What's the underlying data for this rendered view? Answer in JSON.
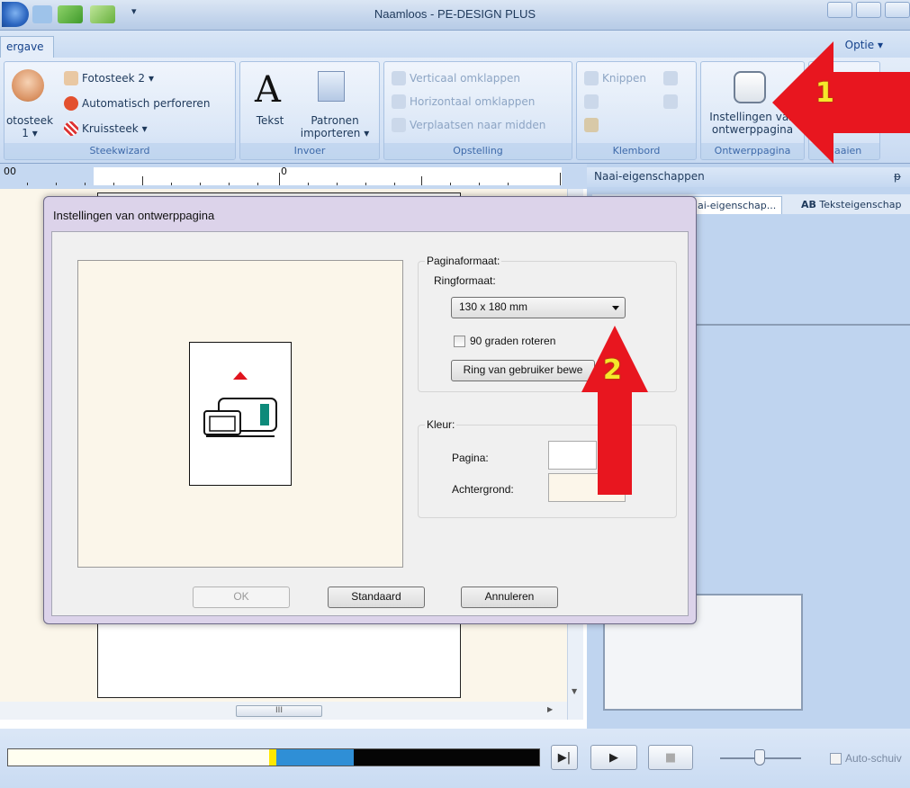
{
  "window": {
    "title": "Naamloos - PE-DESIGN PLUS"
  },
  "ribbon": {
    "active_tab": "ergave",
    "option_tab": "Optie",
    "option_chevron": "▾",
    "groups": {
      "steekwizard": {
        "label": "Steekwizard",
        "big_button_label_1": "otosteek",
        "big_button_label_2": "1",
        "items": [
          "Fotosteek 2",
          "Automatisch perforeren",
          "Kruissteek"
        ]
      },
      "invoer": {
        "label": "Invoer",
        "text_button": "Tekst",
        "text_glyph": "A",
        "import_button_1": "Patronen",
        "import_button_2": "importeren"
      },
      "opstelling": {
        "label": "Opstelling",
        "items": [
          "Verticaal omklappen",
          "Horizontaal omklappen",
          "Verplaatsen naar midden"
        ]
      },
      "klembord": {
        "label": "Klembord",
        "cut": "Knippen"
      },
      "ontwerppagina": {
        "label": "Ontwerppagina",
        "button_1": "Instellingen van",
        "button_2": "ontwerppagina"
      },
      "naaien": {
        "label": "Naaien"
      }
    }
  },
  "ruler": {
    "label_left": "00",
    "label_zero": "0"
  },
  "right_panel": {
    "title": "Naai-eigenschappen",
    "pin": "ᵽ",
    "tabs": [
      "ai-eigenschap...",
      "AB",
      "Teksteigenschap"
    ]
  },
  "hscroll_grip": "III",
  "dialog": {
    "title": "Instellingen van ontwerppagina",
    "page_size": {
      "legend": "Paginaformaat:",
      "hoop_label": "Ringformaat:",
      "hoop_value": "130 x 180 mm",
      "rotate_label": "90 graden roteren",
      "rotate_checked": false,
      "custom_button": "Ring van gebruiker bewe"
    },
    "color": {
      "legend": "Kleur:",
      "page_label": "Pagina:",
      "background_label": "Achtergrond:"
    },
    "buttons": {
      "ok": "OK",
      "default": "Standaard",
      "cancel": "Annuleren"
    }
  },
  "annotations": {
    "arrow1": "1",
    "arrow2": "2",
    "color": "#e8161f"
  },
  "playback": {
    "play_end_glyph": "▶|",
    "play_glyph": "▶",
    "stop_glyph": "■"
  },
  "autoscroll": {
    "label": "Auto-schuiv"
  },
  "colors": {
    "accent": "#15428b",
    "ribbon_bg": "#d2e1f5",
    "page_bg": "#fbf6ea"
  }
}
